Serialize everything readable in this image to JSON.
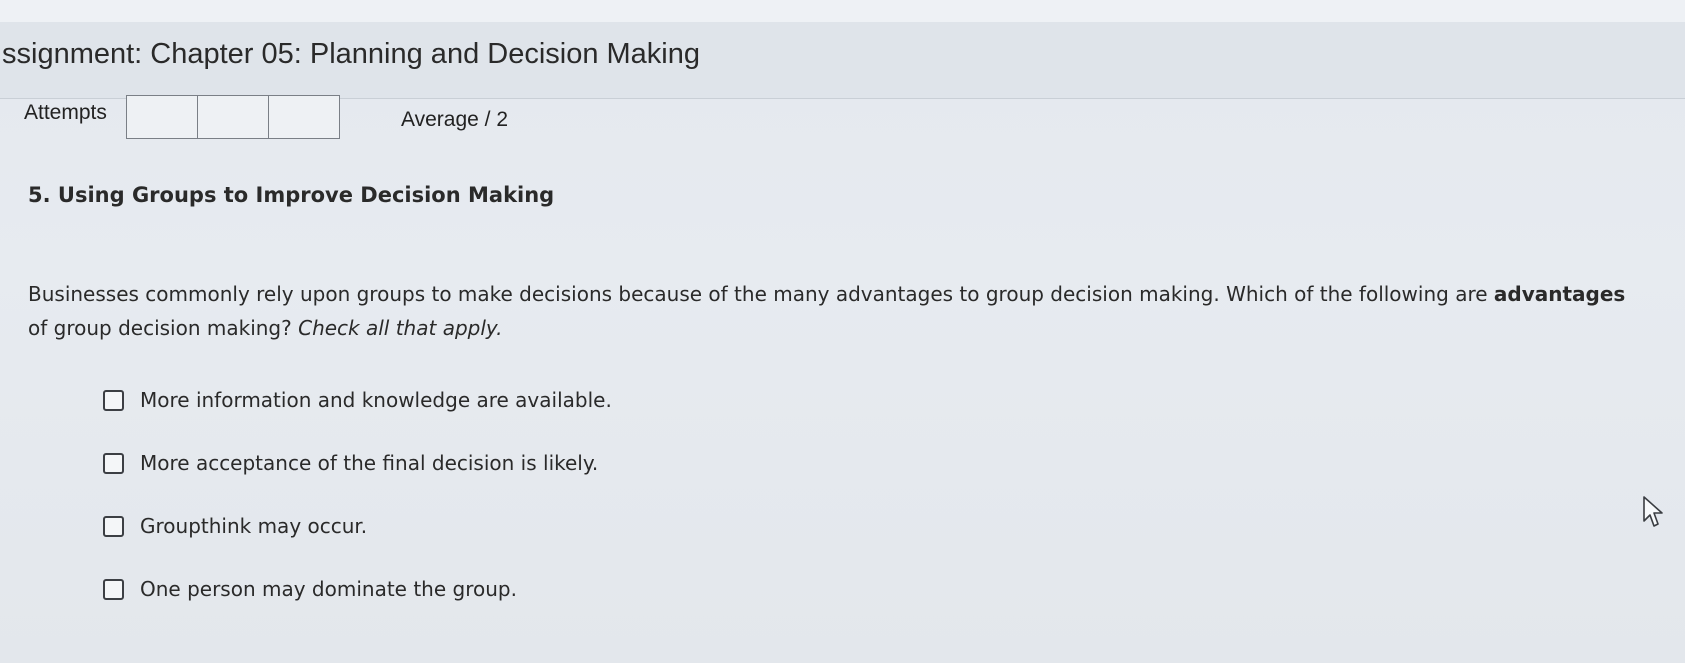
{
  "assignment": {
    "title": "ssignment: Chapter 05: Planning and Decision Making"
  },
  "attempts": {
    "label": "Attempts",
    "boxes": [
      "",
      "",
      ""
    ]
  },
  "score": {
    "label": "Average / 2"
  },
  "question": {
    "heading": "5. Using Groups to Improve Decision Making",
    "text_part1": "Businesses commonly rely upon groups to make decisions because of the many advantages to group decision making. Which of the following are ",
    "text_bold": "advantages",
    "text_part2": " of group decision making? ",
    "instruction": "Check all that apply.",
    "options": [
      {
        "label": "More information and knowledge are available.",
        "checked": false
      },
      {
        "label": "More acceptance of the final decision is likely.",
        "checked": false
      },
      {
        "label": "Groupthink may occur.",
        "checked": false
      },
      {
        "label": "One person may dominate the group.",
        "checked": false
      }
    ]
  },
  "icons": {
    "checkbox": "checkbox-icon",
    "cursor": "mouse-pointer-icon"
  },
  "colors": {
    "background": "#e5e9ee",
    "header": "#dfe4ea",
    "text": "#2a2a2a"
  }
}
